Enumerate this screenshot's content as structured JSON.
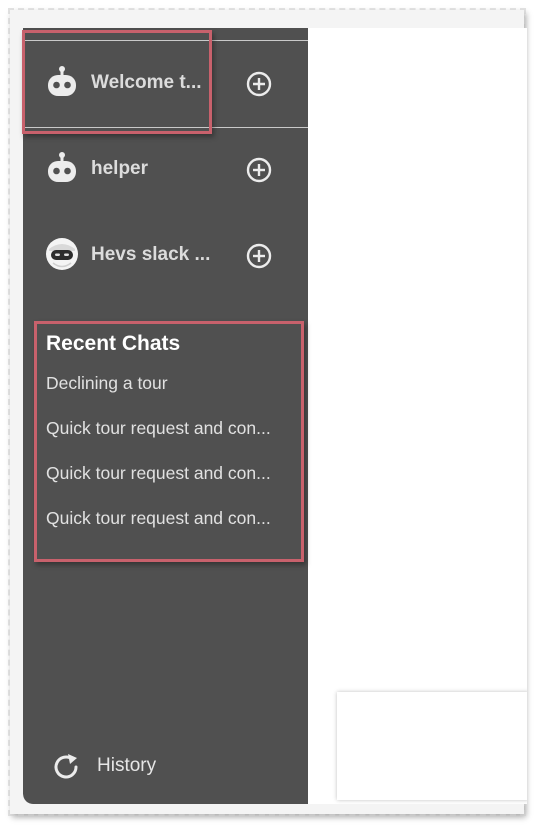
{
  "agents": [
    {
      "name": "Welcome t...",
      "icon": "robot-icon"
    },
    {
      "name": "helper",
      "icon": "robot-icon"
    },
    {
      "name": "Hevs slack ...",
      "icon": "masked-avatar-icon"
    }
  ],
  "recent_chats": {
    "title": "Recent Chats",
    "items": [
      "Declining a tour",
      "Quick tour request and con...",
      "Quick tour request and con...",
      "Quick tour request and con..."
    ]
  },
  "history": {
    "label": "History",
    "icon": "refresh-icon"
  },
  "colors": {
    "sidebar": "#505050",
    "highlight": "#c8616c"
  }
}
